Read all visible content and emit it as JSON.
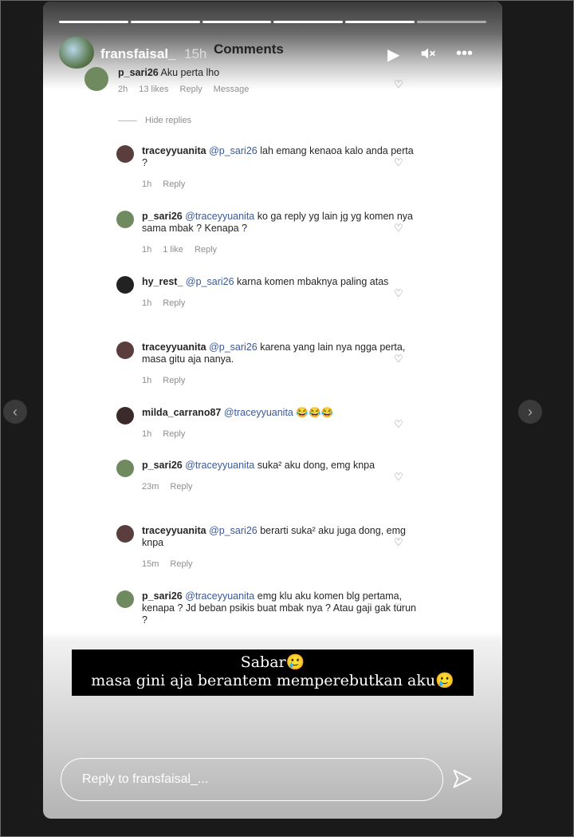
{
  "story": {
    "username": "fransfaisal_",
    "time": "15h",
    "comments_title": "Comments",
    "progress_segments": 6,
    "progress_done": 5
  },
  "comments": [
    {
      "user": "p_sari26",
      "mention": "",
      "text": "Aku perta lho",
      "meta": [
        "2h",
        "13 likes",
        "Reply",
        "Message"
      ]
    },
    {
      "user": "traceyyuanita",
      "mention": "@p_sari26",
      "text": "lah emang kenaoa kalo anda perta ?",
      "meta": [
        "1h",
        "Reply"
      ]
    },
    {
      "user": "p_sari26",
      "mention": "@traceyyuanita",
      "text": "ko ga reply yg lain jg yg komen nya sama mbak ? Kenapa ?",
      "meta": [
        "1h",
        "1 like",
        "Reply"
      ]
    },
    {
      "user": "hy_rest_",
      "mention": "@p_sari26",
      "text": "karna komen mbaknya paling atas",
      "meta": [
        "1h",
        "Reply"
      ]
    },
    {
      "user": "traceyyuanita",
      "mention": "@p_sari26",
      "text": "karena yang lain nya ngga perta, masa gitu aja nanya.",
      "meta": [
        "1h",
        "Reply"
      ]
    },
    {
      "user": "milda_carrano87",
      "mention": "@traceyyuanita",
      "text": "😂😂😂",
      "meta": [
        "1h",
        "Reply"
      ]
    },
    {
      "user": "p_sari26",
      "mention": "@traceyyuanita",
      "text": "suka² aku dong, emg knpa",
      "meta": [
        "23m",
        "Reply"
      ]
    },
    {
      "user": "traceyyuanita",
      "mention": "@p_sari26",
      "text": "berarti suka² aku juga dong, emg knpa",
      "meta": [
        "15m",
        "Reply"
      ]
    },
    {
      "user": "p_sari26",
      "mention": "@traceyyuanita",
      "text": "emg klu aku komen blg pertama, kenapa ? Jd beban psikis buat mbak nya ? Atau gaji gak turun ?",
      "meta": []
    }
  ],
  "hide_replies": "Hide replies",
  "caption": {
    "line1": "Sabar🥲",
    "line2": "masa gini aja berantem memperebutkan aku🥲"
  },
  "reply_placeholder": "Reply to fransfaisal_...",
  "colors": {
    "background": "#1a1a1a",
    "mention": "#3b5998",
    "meta": "#8e8e8e"
  },
  "icons": {
    "play": "play-icon",
    "mute": "mute-icon",
    "more": "more-icon",
    "send": "send-icon",
    "heart": "heart-icon"
  }
}
